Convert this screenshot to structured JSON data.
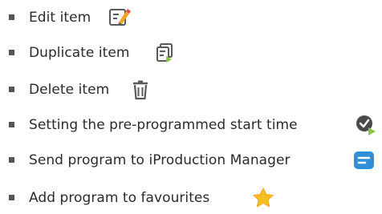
{
  "list": {
    "items": [
      {
        "label": "Edit item",
        "icon": "edit-icon"
      },
      {
        "label": "Duplicate item",
        "icon": "duplicate-icon"
      },
      {
        "label": "Delete item",
        "icon": "trash-icon"
      },
      {
        "label": "Setting the pre-programmed start time",
        "icon": "clock-play-icon"
      },
      {
        "label": "Send program to iProduction Manager",
        "icon": "send-message-icon"
      },
      {
        "label": "Add program to favourites",
        "icon": "star-icon"
      }
    ]
  },
  "colors": {
    "text": "#2b2b2b",
    "bullet": "#555555",
    "icon_dark": "#5a5a5a",
    "icon_green": "#8cc63f",
    "icon_orange": "#f4a422",
    "icon_blue": "#2f8fd8",
    "icon_star": "#fbbf24"
  }
}
